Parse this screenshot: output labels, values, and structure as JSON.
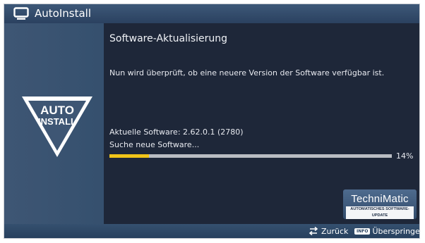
{
  "window": {
    "title": "AutoInstall",
    "icon": "tv-icon"
  },
  "sidebar": {
    "logo_line1": "AUTO",
    "logo_line2": "INSTALL"
  },
  "main": {
    "heading": "Software-Aktualisierung",
    "message": "Nun wird überprüft, ob eine neuere Version der Software verfügbar ist.",
    "current_software": "Aktuelle Software: 2.62.0.1 (2780)",
    "status": "Suche neue Software...",
    "progress": {
      "value_percent": 14,
      "label": "14%"
    }
  },
  "brand": {
    "name": "TechniMatic",
    "tagline": "AUTOMATISCHES SOFTWARE-UPDATE"
  },
  "footer": {
    "back_label": "Zurück",
    "info_key": "INFO",
    "skip_label": "Überspringen"
  },
  "colors": {
    "background": "#1e2739",
    "titlebar": "#2b4160",
    "sidebar": "#3e5674",
    "progress_fill": "#f0c419",
    "progress_track": "#b9bcc2"
  }
}
